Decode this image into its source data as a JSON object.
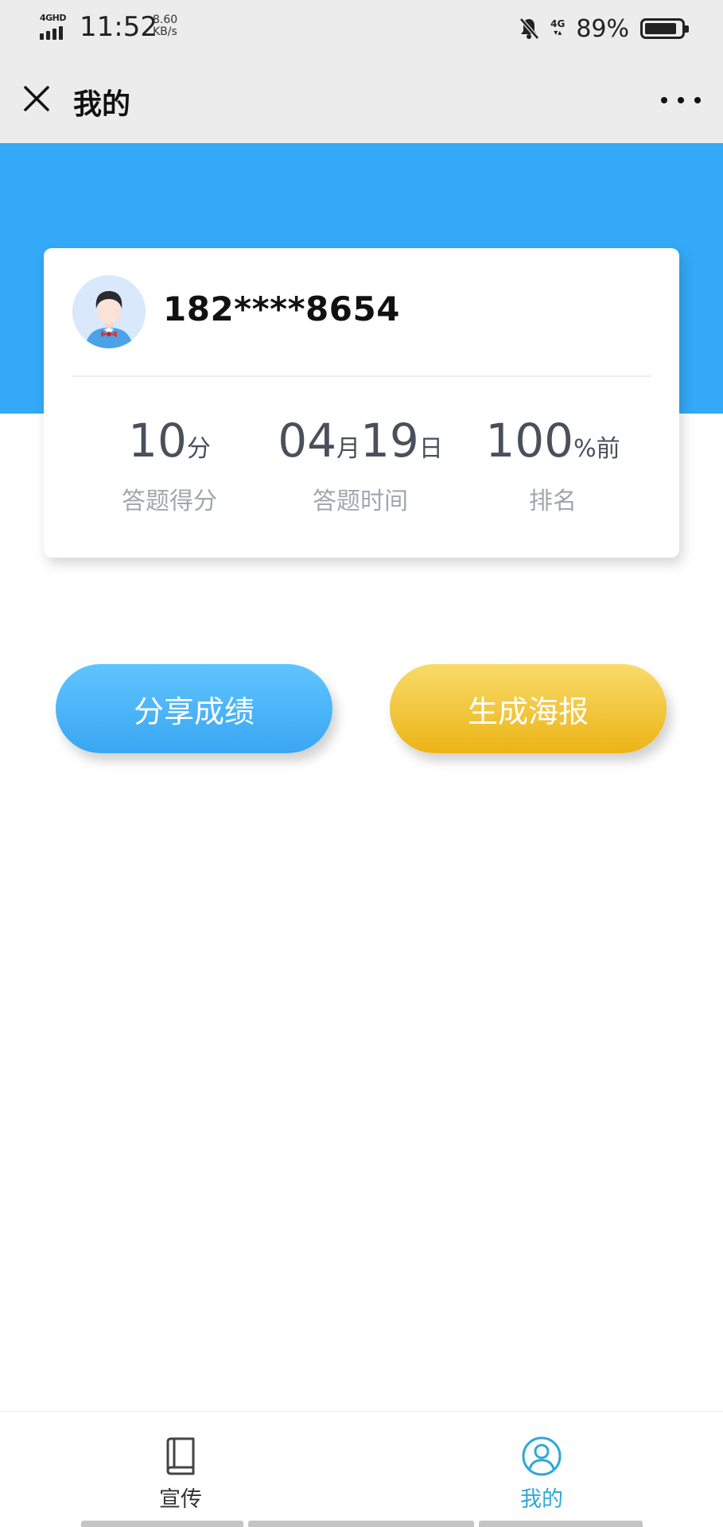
{
  "status_bar": {
    "network_tag": "4GHD",
    "time": "11:52",
    "speed_value": "8.60",
    "speed_unit": "KB/s",
    "net_type": "4G",
    "battery": "89%",
    "battery_level": 0.89,
    "icons": [
      "signal-icon",
      "mute-bell-icon",
      "battery-icon"
    ]
  },
  "title_bar": {
    "title": "我的",
    "icons": [
      "close-icon",
      "more-icon"
    ]
  },
  "profile": {
    "phone": "182****8654",
    "avatar_icon": "avatar-icon"
  },
  "stats": [
    {
      "value": "10",
      "unit": "分",
      "label": "答题得分"
    },
    {
      "month": "04",
      "month_unit": "月",
      "day": "19",
      "day_unit": "日",
      "label": "答题时间"
    },
    {
      "value": "100",
      "unit": "%前",
      "label": "排名"
    }
  ],
  "actions": {
    "share_label": "分享成绩",
    "poster_label": "生成海报"
  },
  "tab_bar": {
    "tabs": [
      {
        "label": "宣传",
        "icon": "book-icon",
        "active": false
      },
      {
        "label": "我的",
        "icon": "user-icon",
        "active": true
      }
    ]
  },
  "colors": {
    "header_blue": "#33a9f7",
    "share_button": "#45b3f6",
    "poster_button": "#f1c232",
    "active_tab": "#30a8d6",
    "stat_value": "#4a4f5c",
    "stat_label": "#a2a6ad"
  }
}
